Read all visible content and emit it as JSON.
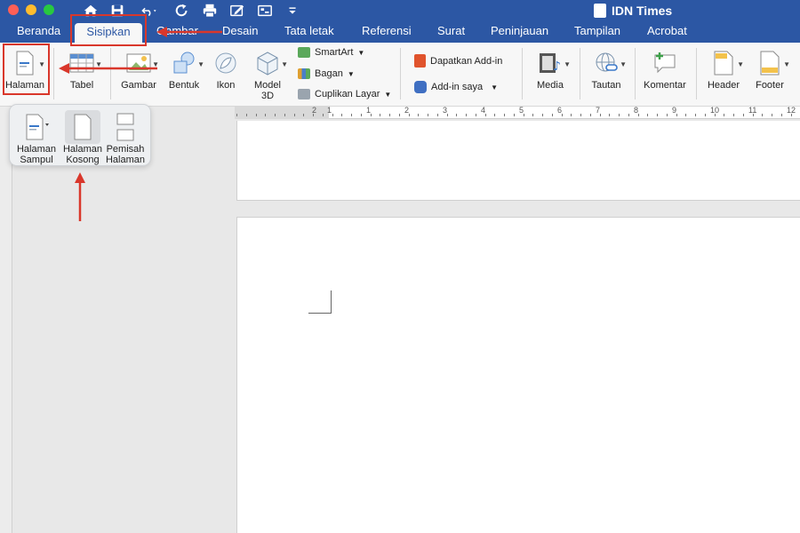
{
  "window": {
    "title": "IDN Times",
    "colors": {
      "accent": "#2c57a4",
      "annotation": "#d9372b"
    }
  },
  "quick_access": [
    "home-icon",
    "save-icon",
    "undo-icon",
    "redo-icon",
    "print-icon",
    "edit-icon",
    "screen-icon",
    "customize-icon"
  ],
  "tabs": [
    {
      "label": "Beranda"
    },
    {
      "label": "Sisipkan"
    },
    {
      "label": "Gambar"
    },
    {
      "label": "Desain"
    },
    {
      "label": "Tata letak"
    },
    {
      "label": "Referensi"
    },
    {
      "label": "Surat"
    },
    {
      "label": "Peninjauan"
    },
    {
      "label": "Tampilan"
    },
    {
      "label": "Acrobat"
    }
  ],
  "ribbon": {
    "halaman": "Halaman",
    "tabel": "Tabel",
    "gambar": "Gambar",
    "bentuk": "Bentuk",
    "ikon": "Ikon",
    "model3d_line1": "Model",
    "model3d_line2": "3D",
    "smartart": "SmartArt",
    "bagan": "Bagan",
    "cuplikan": "Cuplikan Layar",
    "addin_get": "Dapatkan Add-in",
    "addin_my": "Add-in saya",
    "media": "Media",
    "tautan": "Tautan",
    "komentar": "Komentar",
    "header": "Header",
    "footer": "Footer"
  },
  "dropdown": {
    "items": [
      {
        "line1": "Halaman",
        "line2": "Sampul"
      },
      {
        "line1": "Halaman",
        "line2": "Kosong"
      },
      {
        "line1": "Pemisah",
        "line2": "Halaman"
      }
    ]
  },
  "ruler": {
    "numbers": [
      "2",
      "1",
      "1",
      "2",
      "3",
      "4",
      "5",
      "6",
      "7",
      "8",
      "9",
      "10",
      "11",
      "12"
    ]
  }
}
